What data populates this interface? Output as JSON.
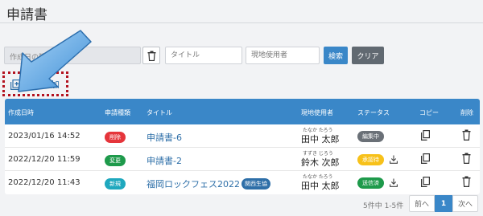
{
  "page": {
    "title": "申請書"
  },
  "filters": {
    "date_range_placeholder": "作成日の範囲",
    "title_placeholder": "タイトル",
    "user_placeholder": "現地使用者",
    "search_label": "検索",
    "clear_label": "クリア"
  },
  "toolbar": {
    "add_label": "新規追加"
  },
  "table": {
    "headers": [
      "作成日時",
      "申請種類",
      "タイトル",
      "現地使用者",
      "ステータス",
      "コピー",
      "削除"
    ],
    "rows": [
      {
        "date": "2023/01/16 14:52",
        "type": "削除",
        "type_color": "#e5353b",
        "title": "申請書-6",
        "badge": "",
        "ruby": "たなか たろう",
        "user": "田中 太郎",
        "status": "編集中",
        "status_bg": "#6a7077",
        "status_fg": "#ffffff",
        "download": false
      },
      {
        "date": "2022/12/20 11:59",
        "type": "変更",
        "type_color": "#1e9a4b",
        "title": "申請書-2",
        "badge": "",
        "ruby": "すずき じろう",
        "user": "鈴木 次郎",
        "status": "承認待",
        "status_bg": "#f7c11a",
        "status_fg": "#ffffff",
        "download": true
      },
      {
        "date": "2022/12/20 11:43",
        "type": "新規",
        "type_color": "#1fa8be",
        "title": "福岡ロックフェス2022",
        "badge": "関西生協",
        "ruby": "たなか たろう",
        "user": "田中 太郎",
        "status": "送信済",
        "status_bg": "#1e9a4b",
        "status_fg": "#ffffff",
        "download": true
      }
    ]
  },
  "pagination": {
    "info": "5件中 1-5件",
    "prev_label": "前へ",
    "current_page": "1",
    "next_label": "次へ"
  },
  "colors": {
    "accent": "#3a87c8",
    "highlight": "#b3121f"
  }
}
